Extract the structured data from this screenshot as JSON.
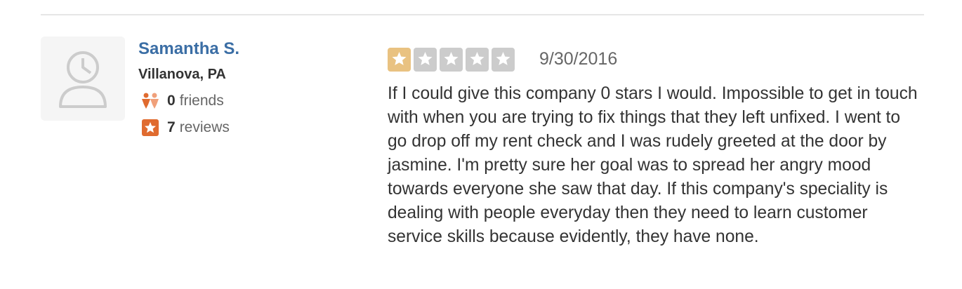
{
  "user": {
    "name": "Samantha S.",
    "location": "Villanova, PA",
    "friends_count": "0",
    "friends_label": "friends",
    "reviews_count": "7",
    "reviews_label": "reviews",
    "avatar_icon": "default-user-avatar-icon",
    "friends_icon": "friends-icon",
    "reviews_icon": "review-star-icon"
  },
  "review": {
    "rating": 1,
    "max_rating": 5,
    "date": "9/30/2016",
    "text": "If I could give this company 0 stars I would. Impossible to get in touch with when you are trying to fix things that they left unfixed. I went to go drop off my rent check and I was rudely greeted at the door by jasmine. I'm pretty sure her goal was to spread her angry mood towards everyone she saw that day. If this company's speciality is dealing with people everyday then they need to learn customer service skills because evidently, they have none."
  },
  "colors": {
    "user_name": "#3b6ea5",
    "star_filled": "#e9c281",
    "star_empty": "#cccccc",
    "stat_icon": "#e06b2f",
    "divider": "#e6e6e6"
  }
}
